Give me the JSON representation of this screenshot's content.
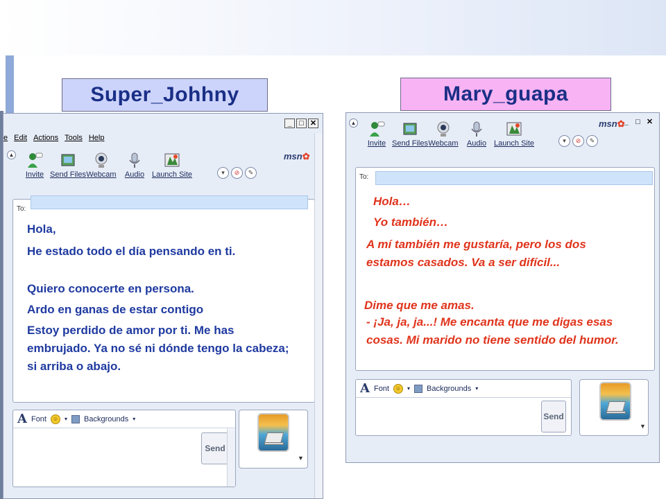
{
  "left": {
    "contact_name": "Super_Johhny",
    "window_buttons": [
      "_",
      "□",
      "✕"
    ],
    "menu": [
      "e",
      "Edit",
      "Actions",
      "Tools",
      "Help"
    ],
    "toolbar": [
      "Invite",
      "Send Files",
      "Webcam",
      "Audio",
      "Launch Site"
    ],
    "brand": "msn",
    "to_label": "To:",
    "messages": [
      "Hola,",
      "He estado todo el día pensando en ti.",
      "Quiero conocerte en persona.",
      "Ardo en ganas de estar contigo",
      "Estoy perdido de amor por ti. Me has embrujado. Ya no sé ni dónde tengo la cabeza; si arriba o abajo."
    ],
    "font_label": "Font",
    "backgrounds_label": "Backgrounds",
    "send_label": "Send"
  },
  "right": {
    "contact_name": "Mary_guapa",
    "window_buttons": [
      "_",
      "□",
      "✕"
    ],
    "toolbar": [
      "Invite",
      "Send Files",
      "Webcam",
      "Audio",
      "Launch Site"
    ],
    "brand": "msn",
    "to_label": "To:",
    "messages": [
      "Hola…",
      "Yo también…",
      "A mí también me gustaría, pero los dos estamos casados. Va a ser difícil...",
      "Dime que me amas.",
      "- ¡Ja, ja, ja...! Me encanta que me digas esas cosas. Mi marido no tiene sentido del humor."
    ],
    "font_label": "Font",
    "backgrounds_label": "Backgrounds",
    "send_label": "Send"
  },
  "colors": {
    "left_name_bg": "#cdd4fb",
    "right_name_bg": "#f7b3f3",
    "left_text": "#1f3aa0",
    "right_text": "#e0341c",
    "to_field": "#cfe4fb"
  }
}
